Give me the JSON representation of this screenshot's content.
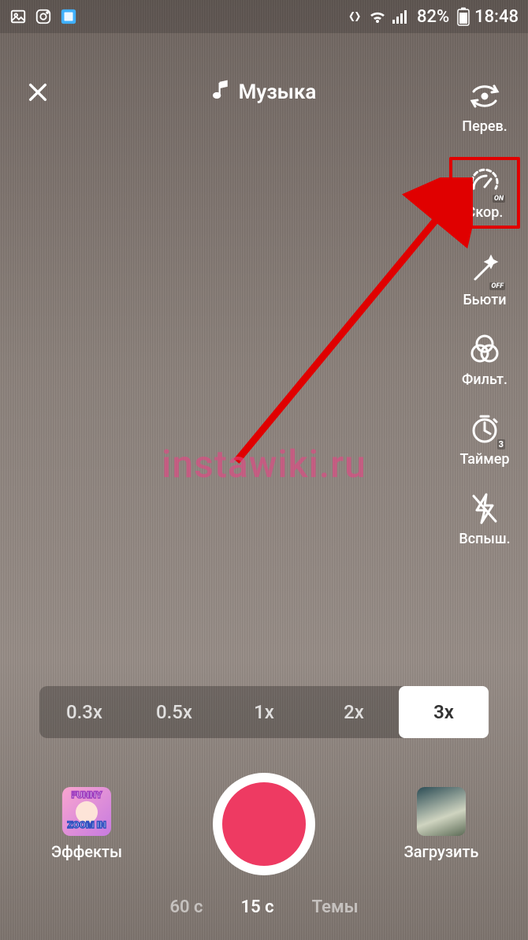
{
  "status": {
    "battery_percent": "82%",
    "time": "18:48"
  },
  "top": {
    "music_label": "Музыка"
  },
  "tools": {
    "flip": "Перев.",
    "speed": "Скор.",
    "speed_badge": "ON",
    "beauty": "Бьюти",
    "beauty_badge": "OFF",
    "filter": "Фильт.",
    "timer": "Таймер",
    "timer_badge": "3",
    "flash": "Вспыш."
  },
  "watermark": "instawiki.ru",
  "speed_options": [
    "0.3x",
    "0.5x",
    "1x",
    "2x",
    "3x"
  ],
  "speed_active_index": 4,
  "effects": {
    "label": "Эффекты",
    "thumb_line1": "FUNNY",
    "thumb_line2": "ZOOM IN"
  },
  "upload": {
    "label": "Загрузить"
  },
  "duration": {
    "options": [
      "60 с",
      "15 с",
      "Темы"
    ],
    "active_index": 1
  }
}
